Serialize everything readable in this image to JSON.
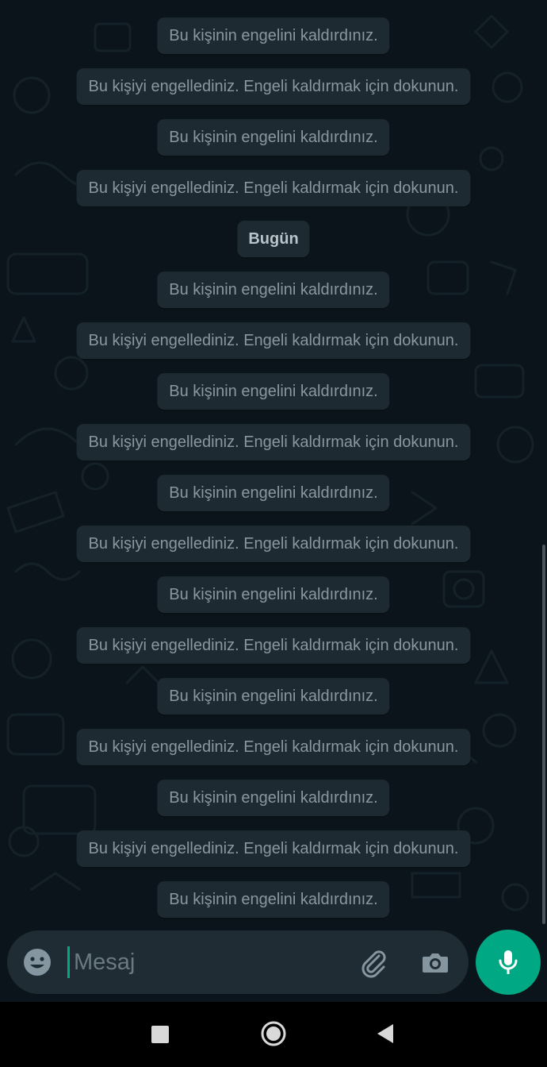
{
  "chat": {
    "messages": [
      {
        "kind": "system",
        "text": "Bu kişinin engelini kaldırdınız."
      },
      {
        "kind": "system",
        "text": "Bu kişiyi engellediniz. Engeli kaldırmak için dokunun."
      },
      {
        "kind": "system",
        "text": "Bu kişinin engelini kaldırdınız."
      },
      {
        "kind": "system",
        "text": "Bu kişiyi engellediniz. Engeli kaldırmak için dokunun."
      },
      {
        "kind": "date",
        "text": "Bugün"
      },
      {
        "kind": "system",
        "text": "Bu kişinin engelini kaldırdınız."
      },
      {
        "kind": "system",
        "text": "Bu kişiyi engellediniz. Engeli kaldırmak için dokunun."
      },
      {
        "kind": "system",
        "text": "Bu kişinin engelini kaldırdınız."
      },
      {
        "kind": "system",
        "text": "Bu kişiyi engellediniz. Engeli kaldırmak için dokunun."
      },
      {
        "kind": "system",
        "text": "Bu kişinin engelini kaldırdınız."
      },
      {
        "kind": "system",
        "text": "Bu kişiyi engellediniz. Engeli kaldırmak için dokunun."
      },
      {
        "kind": "system",
        "text": "Bu kişinin engelini kaldırdınız."
      },
      {
        "kind": "system",
        "text": "Bu kişiyi engellediniz. Engeli kaldırmak için dokunun."
      },
      {
        "kind": "system",
        "text": "Bu kişinin engelini kaldırdınız."
      },
      {
        "kind": "system",
        "text": "Bu kişiyi engellediniz. Engeli kaldırmak için dokunun."
      },
      {
        "kind": "system",
        "text": "Bu kişinin engelini kaldırdınız."
      },
      {
        "kind": "system",
        "text": "Bu kişiyi engellediniz. Engeli kaldırmak için dokunun."
      },
      {
        "kind": "system",
        "text": "Bu kişinin engelini kaldırdınız."
      }
    ]
  },
  "composer": {
    "placeholder": "Mesaj",
    "value": "",
    "icons": {
      "emoji": "emoji-icon",
      "attach": "paperclip-icon",
      "camera": "camera-icon",
      "mic": "microphone-icon"
    }
  },
  "navbar": {
    "icons": [
      "recents-square-icon",
      "home-circle-icon",
      "back-triangle-icon"
    ]
  },
  "colors": {
    "background": "#0b141a",
    "bubble": "#1d2a32",
    "bubble_text": "#8a979e",
    "composer": "#1f2c34",
    "accent": "#00a884"
  }
}
